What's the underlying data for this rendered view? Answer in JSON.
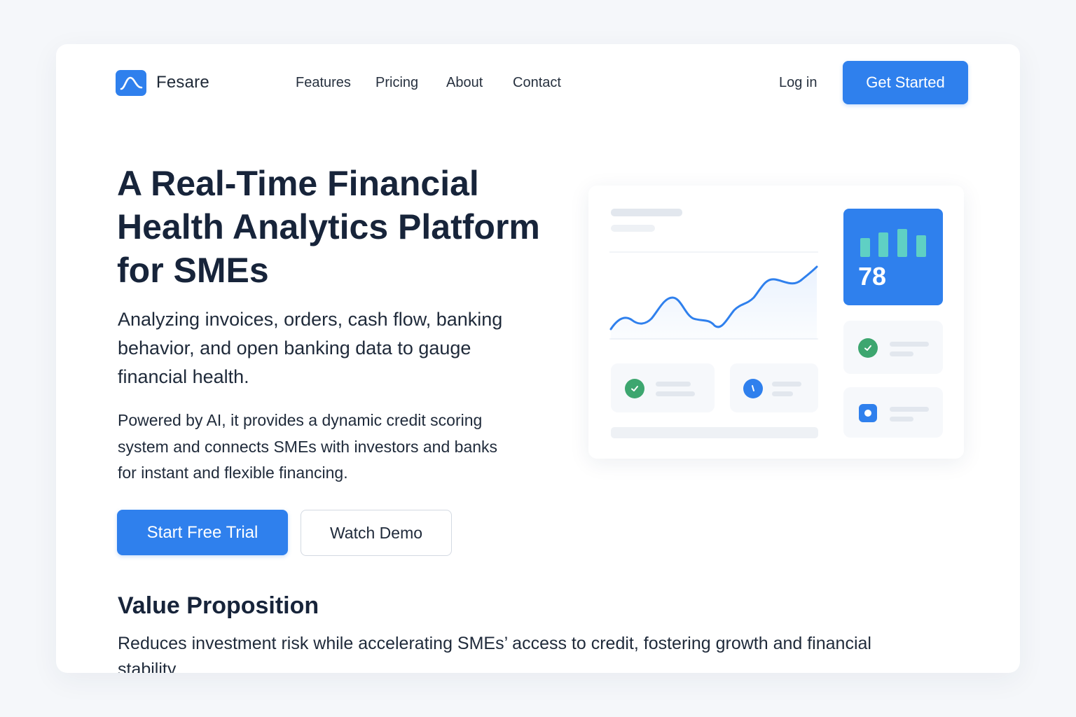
{
  "nav": {
    "brand": "Fesare",
    "links": [
      "Features",
      "Pricing",
      "About",
      "Contact"
    ],
    "login": "Log in",
    "cta": "Get Started"
  },
  "hero": {
    "title_lines": [
      "A Real-Time Financial",
      "Health Analytics Platform",
      "for SMEs"
    ],
    "subtitle_lines": [
      "Analyzing invoices, orders, cash flow, banking",
      "behavior, and open banking data to gauge",
      "financial health."
    ],
    "description_lines": [
      "Powered by AI, it provides a dynamic credit scoring",
      "system and connects SMEs with investors and banks",
      "for instant and flexible financing."
    ],
    "primary_button": "Start Free Trial",
    "secondary_button": "Watch Demo"
  },
  "value_proposition": {
    "title": "Value Proposition",
    "text": "Reduces investment risk while accelerating SMEs’ access to credit, fostering growth and financial stability."
  },
  "dashboard": {
    "score": "78",
    "colors": {
      "accent": "#2f80ed",
      "success": "#3da66f",
      "bar": "#5fd0c4"
    }
  }
}
